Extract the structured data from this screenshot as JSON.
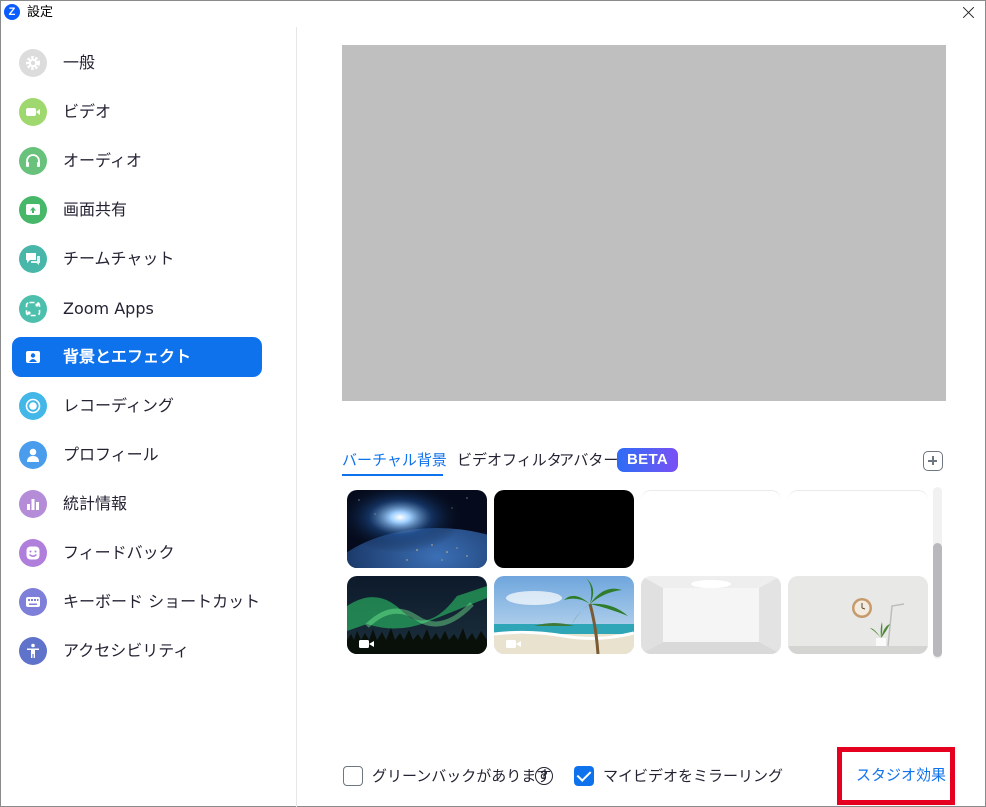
{
  "window": {
    "title": "設定",
    "logo_letter": "Z"
  },
  "sidebar": {
    "items": [
      {
        "label": "一般",
        "icon": "gear-icon",
        "color": "#dcdcdc"
      },
      {
        "label": "ビデオ",
        "icon": "video-camera-icon",
        "color": "#9fd86f"
      },
      {
        "label": "オーディオ",
        "icon": "headphones-icon",
        "color": "#68c27c"
      },
      {
        "label": "画面共有",
        "icon": "share-screen-icon",
        "color": "#47b86a"
      },
      {
        "label": "チームチャット",
        "icon": "chat-icon",
        "color": "#48b7a9"
      },
      {
        "label": "Zoom Apps",
        "icon": "apps-icon",
        "color": "#4cbfad"
      },
      {
        "label": "背景とエフェクト",
        "icon": "background-icon",
        "color": "#0e72ed",
        "active": true
      },
      {
        "label": "レコーディング",
        "icon": "record-icon",
        "color": "#43b7e8"
      },
      {
        "label": "プロフィール",
        "icon": "profile-icon",
        "color": "#4a9cec"
      },
      {
        "label": "統計情報",
        "icon": "statistics-icon",
        "color": "#b58cd8"
      },
      {
        "label": "フィードバック",
        "icon": "feedback-icon",
        "color": "#b07fdc"
      },
      {
        "label": "キーボード ショートカット",
        "icon": "keyboard-icon",
        "color": "#7d7fd9"
      },
      {
        "label": "アクセシビリティ",
        "icon": "accessibility-icon",
        "color": "#5e73c9"
      }
    ]
  },
  "tabs": [
    {
      "label": "バーチャル背景",
      "active": true
    },
    {
      "label": "ビデオフィルタ",
      "active": false
    },
    {
      "label": "アバター",
      "active": false
    }
  ],
  "beta_badge": "BETA",
  "backgrounds": [
    {
      "name": "earth-from-space",
      "video": false
    },
    {
      "name": "black",
      "video": false
    },
    {
      "name": "white-blank-1",
      "video": false
    },
    {
      "name": "white-blank-2",
      "video": false
    },
    {
      "name": "aurora",
      "video": true
    },
    {
      "name": "palm-beach",
      "video": true
    },
    {
      "name": "white-room",
      "video": false
    },
    {
      "name": "wall-clock-plant",
      "video": false
    }
  ],
  "options": {
    "green_screen_label": "グリーンバックがあります",
    "green_screen_checked": false,
    "mirror_label": "マイビデオをミラーリング",
    "mirror_checked": true,
    "help_symbol": "?"
  },
  "studio_effects_label": "スタジオ効果",
  "colors": {
    "accent": "#0e72ed",
    "highlight": "#e5001f",
    "preview": "#bfbfbf"
  }
}
